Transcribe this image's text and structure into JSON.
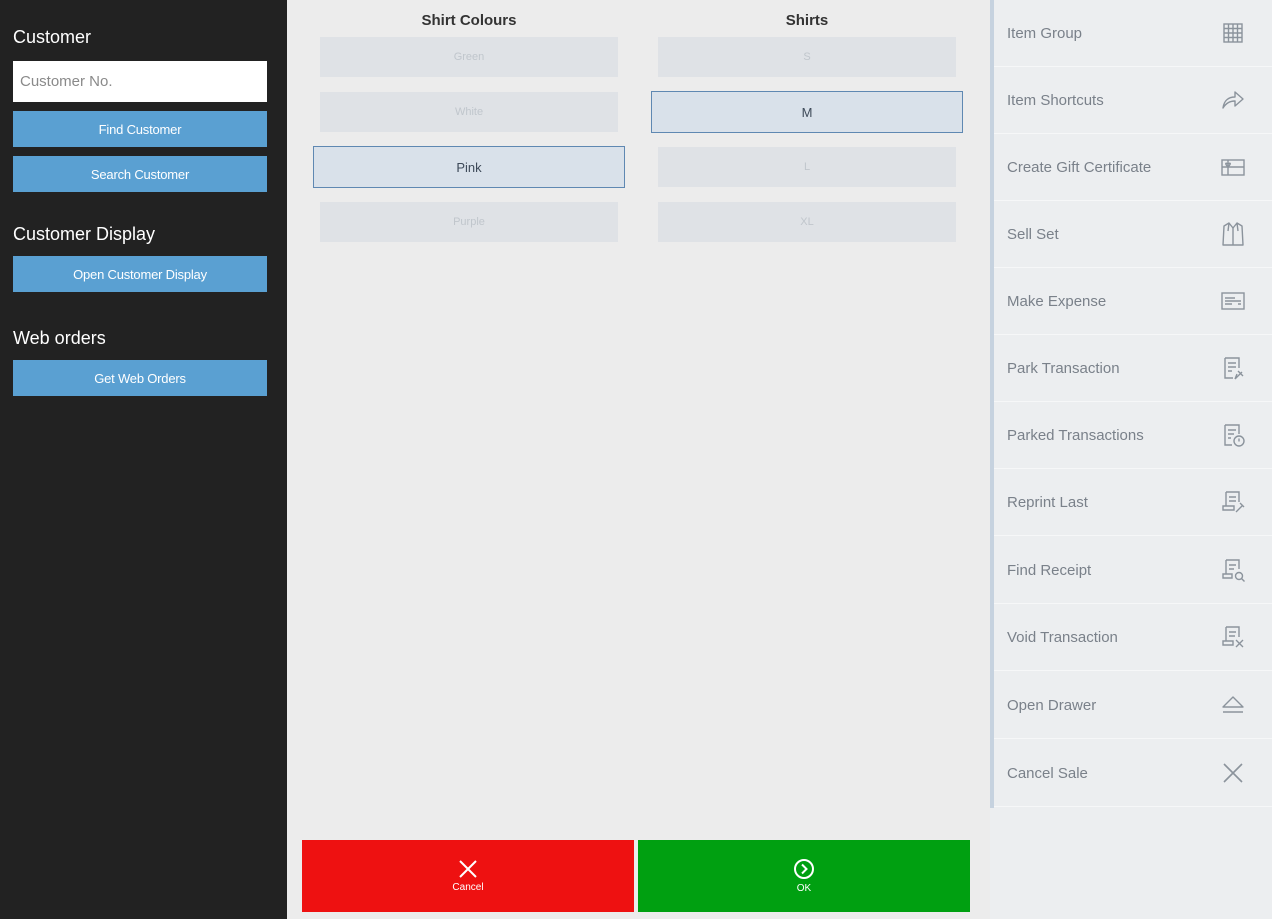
{
  "left": {
    "customer_title": "Customer",
    "customer_placeholder": "Customer No.",
    "find_customer": "Find Customer",
    "search_customer": "Search Customer",
    "display_title": "Customer Display",
    "open_display": "Open Customer Display",
    "web_title": "Web orders",
    "get_web_orders": "Get Web Orders"
  },
  "center": {
    "colours_title": "Shirt Colours",
    "shirts_title": "Shirts",
    "colours": [
      "Green",
      "White",
      "Pink",
      "Purple"
    ],
    "selected_colour": "Pink",
    "sizes": [
      "S",
      "M",
      "L",
      "XL"
    ],
    "selected_size": "M",
    "cancel_label": "Cancel",
    "ok_label": "OK"
  },
  "menu": [
    {
      "label": "Item Group",
      "icon": "grid-icon"
    },
    {
      "label": "Item Shortcuts",
      "icon": "share-arrow-icon"
    },
    {
      "label": "Create Gift Certificate",
      "icon": "gift-card-icon"
    },
    {
      "label": "Sell Set",
      "icon": "jacket-icon"
    },
    {
      "label": "Make Expense",
      "icon": "expense-card-icon"
    },
    {
      "label": "Park Transaction",
      "icon": "receipt-pin-icon"
    },
    {
      "label": "Parked Transactions",
      "icon": "receipt-clock-icon"
    },
    {
      "label": "Reprint Last",
      "icon": "receipt-edit-icon"
    },
    {
      "label": "Find Receipt",
      "icon": "receipt-search-icon"
    },
    {
      "label": "Void Transaction",
      "icon": "receipt-void-icon"
    },
    {
      "label": "Open Drawer",
      "icon": "eject-icon"
    },
    {
      "label": "Cancel Sale",
      "icon": "close-icon"
    }
  ],
  "colors": {
    "sidebar_bg": "#222222",
    "button_blue": "#5aa0d2",
    "cancel_red": "#ee1111",
    "ok_green": "#00a011",
    "selected_border": "#5f88b2"
  }
}
